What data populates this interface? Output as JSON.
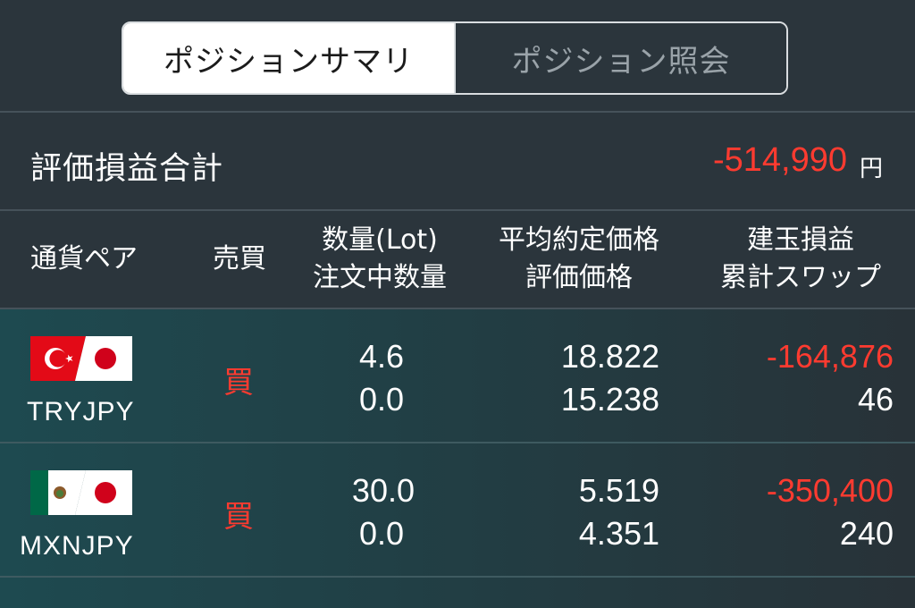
{
  "tabs": {
    "summary_label": "ポジションサマリ",
    "inquiry_label": "ポジション照会"
  },
  "summary": {
    "label": "評価損益合計",
    "value": "-514,990",
    "unit": "円"
  },
  "columns": {
    "pair": "通貨ペア",
    "side": "売買",
    "qty_line1": "数量(Lot)",
    "qty_line2": "注文中数量",
    "price_line1": "平均約定価格",
    "price_line2": "評価価格",
    "pl_line1": "建玉損益",
    "pl_line2": "累計スワップ"
  },
  "positions": [
    {
      "pair": "TRYJPY",
      "flag_icon": "turkey-japan-flag-icon",
      "side": "買",
      "qty": "4.6",
      "order_qty": "0.0",
      "avg_price": "18.822",
      "eval_price": "15.238",
      "pl": "-164,876",
      "swap": "46"
    },
    {
      "pair": "MXNJPY",
      "flag_icon": "mexico-japan-flag-icon",
      "side": "買",
      "qty": "30.0",
      "order_qty": "0.0",
      "avg_price": "5.519",
      "eval_price": "4.351",
      "pl": "-350,400",
      "swap": "240"
    }
  ],
  "colors": {
    "background": "#2b353c",
    "negative": "#ff3b30",
    "buy": "#ff3b30"
  }
}
